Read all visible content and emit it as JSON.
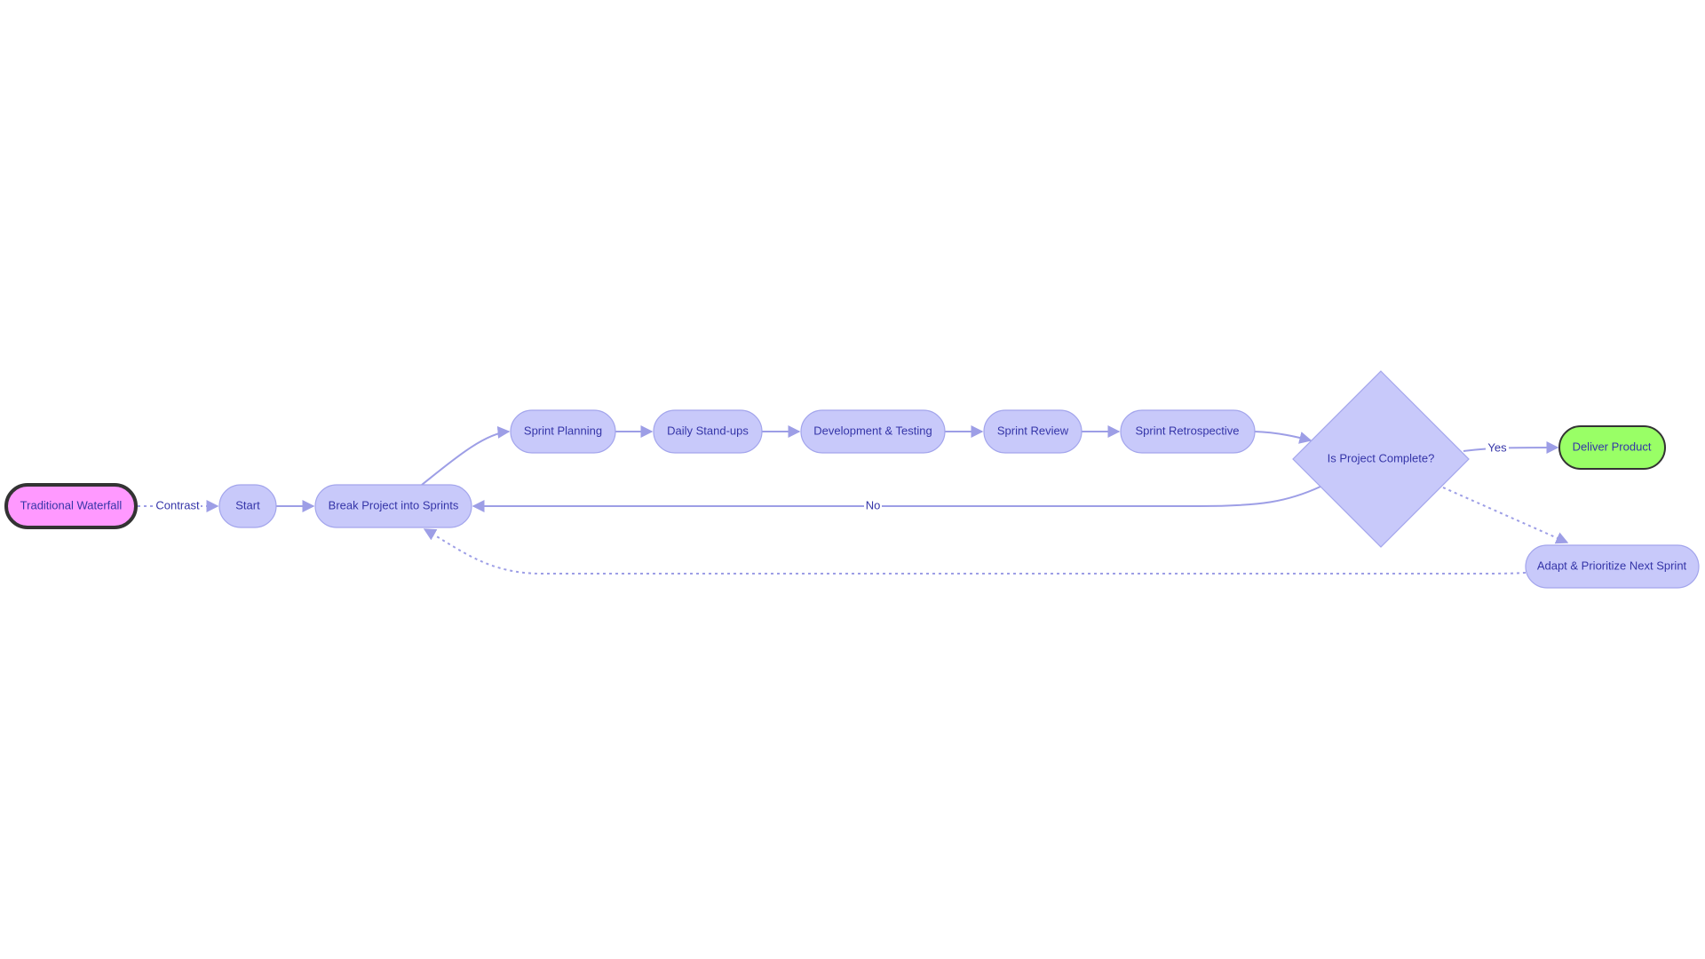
{
  "diagram": {
    "type": "flowchart",
    "colors": {
      "node_fill": "#c8c9fa",
      "node_stroke": "#a3a5ec",
      "text": "#3535a8",
      "edge": "#9d9ee6",
      "waterfall_fill": "#ff99ff",
      "waterfall_stroke": "#333333",
      "deliver_fill": "#99ff66",
      "deliver_stroke": "#333333"
    },
    "nodes": {
      "waterfall": "Traditional Waterfall",
      "start": "Start",
      "break": "Break Project into Sprints",
      "planning": "Sprint Planning",
      "standups": "Daily Stand-ups",
      "devtest": "Development & Testing",
      "review": "Sprint Review",
      "retro": "Sprint Retrospective",
      "decision": "Is Project Complete?",
      "deliver": "Deliver Product",
      "adapt": "Adapt & Prioritize Next Sprint"
    },
    "edge_labels": {
      "contrast": "Contrast",
      "yes": "Yes",
      "no": "No"
    }
  }
}
